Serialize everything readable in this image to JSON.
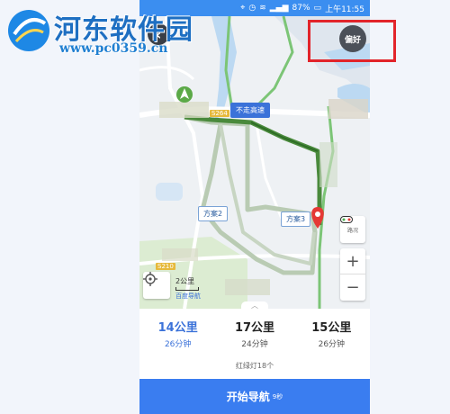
{
  "watermark": {
    "title": "河东软件园",
    "url": "www.pc0359.cn"
  },
  "status_bar": {
    "battery": "87%",
    "time": "上午11:55"
  },
  "map": {
    "preference_label": "偏好",
    "route_labels": {
      "main": "不走高速",
      "plan2": "方案2",
      "plan3": "方案3"
    },
    "road_badges": {
      "top": "S264",
      "bottom": "S210"
    },
    "traffic_label": "路况",
    "scale_label": "2公里",
    "brand": "百度导航",
    "colors": {
      "primary_route": "#4a8a3c",
      "alt_route": "#b9cbb3",
      "water": "#bcd9f2",
      "green": "#cfe8c3"
    }
  },
  "plans": [
    {
      "distance": "14公里",
      "time": "26分钟",
      "active": true
    },
    {
      "distance": "17公里",
      "time": "24分钟",
      "active": false
    },
    {
      "distance": "15公里",
      "time": "26分钟",
      "active": false
    }
  ],
  "traffic_lights": "红绿灯18个",
  "start_button": {
    "label": "开始导航",
    "countdown": "9秒"
  },
  "colors": {
    "accent": "#3a7df0",
    "status_bar": "#3b8ef0",
    "highlight_box": "#e2242a"
  },
  "icons": [
    "back-arrow-icon",
    "destination-marker-icon",
    "start-marker-icon",
    "locate-icon",
    "traffic-icon",
    "zoom-in-icon",
    "zoom-out-icon"
  ]
}
